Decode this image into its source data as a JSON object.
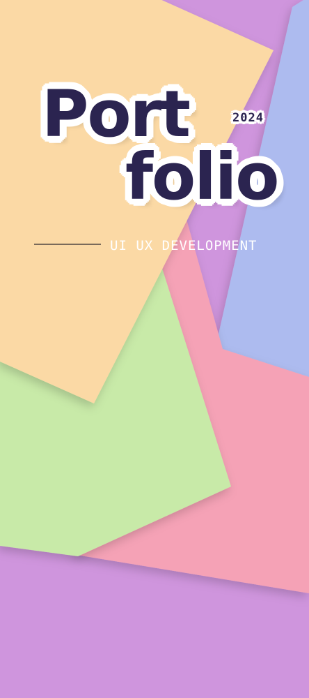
{
  "cover": {
    "title_line1": "Port",
    "title_line2": "folio",
    "year": "2024",
    "subtitle": "UI UX DEVELOPMENT"
  },
  "colors": {
    "purple": "#cf95dd",
    "lavender_blue": "#adbbef",
    "pink": "#f5a2b6",
    "green": "#c8eaa8",
    "peach": "#fbd9a5",
    "title_ink": "#2b2450",
    "title_outline": "#ffffff",
    "subtitle_text": "#ffffff"
  }
}
